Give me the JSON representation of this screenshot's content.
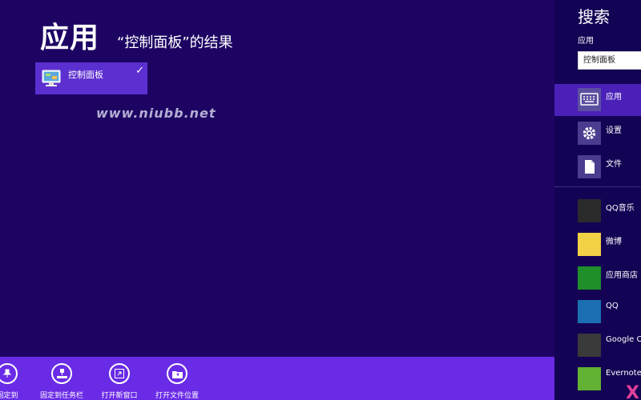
{
  "header": {
    "title": "应用",
    "subtitle": "“控制面板”的结果"
  },
  "results": [
    {
      "label": "控制面板",
      "icon": "control-panel-icon",
      "checked": true
    }
  ],
  "watermark": "www.niubb.net",
  "app_bar": {
    "commands": [
      {
        "label": "固定到",
        "icon": "pin-icon"
      },
      {
        "label": "固定到任务栏",
        "icon": "taskbar-icon"
      },
      {
        "label": "打开新窗口",
        "icon": "new-window-icon"
      },
      {
        "label": "打开文件位置",
        "icon": "folder-icon"
      }
    ]
  },
  "search_charm": {
    "title": "搜索",
    "scope_label": "应用",
    "query": "控制面板",
    "categories": [
      {
        "label": "应用",
        "icon": "keyboard-icon",
        "selected": true
      },
      {
        "label": "设置",
        "icon": "gear-icon",
        "selected": false
      },
      {
        "label": "文件",
        "icon": "file-icon",
        "selected": false
      }
    ],
    "apps": [
      {
        "label": "QQ音乐",
        "color": "#2a2a2a"
      },
      {
        "label": "微博",
        "color": "#f1d146"
      },
      {
        "label": "应用商店",
        "color": "#1e8f2a"
      },
      {
        "label": "QQ",
        "color": "#1d6fb4"
      },
      {
        "label": "Google Chrome",
        "color": "#3a3a3a"
      },
      {
        "label": "Evernote",
        "color": "#62b233"
      }
    ],
    "corner_mark": "X"
  },
  "colors": {
    "background": "#1d0463",
    "tile": "#5c2fd0",
    "app_bar": "#6a2be6",
    "charm": "#140254",
    "charm_selected": "#4a20b8"
  }
}
